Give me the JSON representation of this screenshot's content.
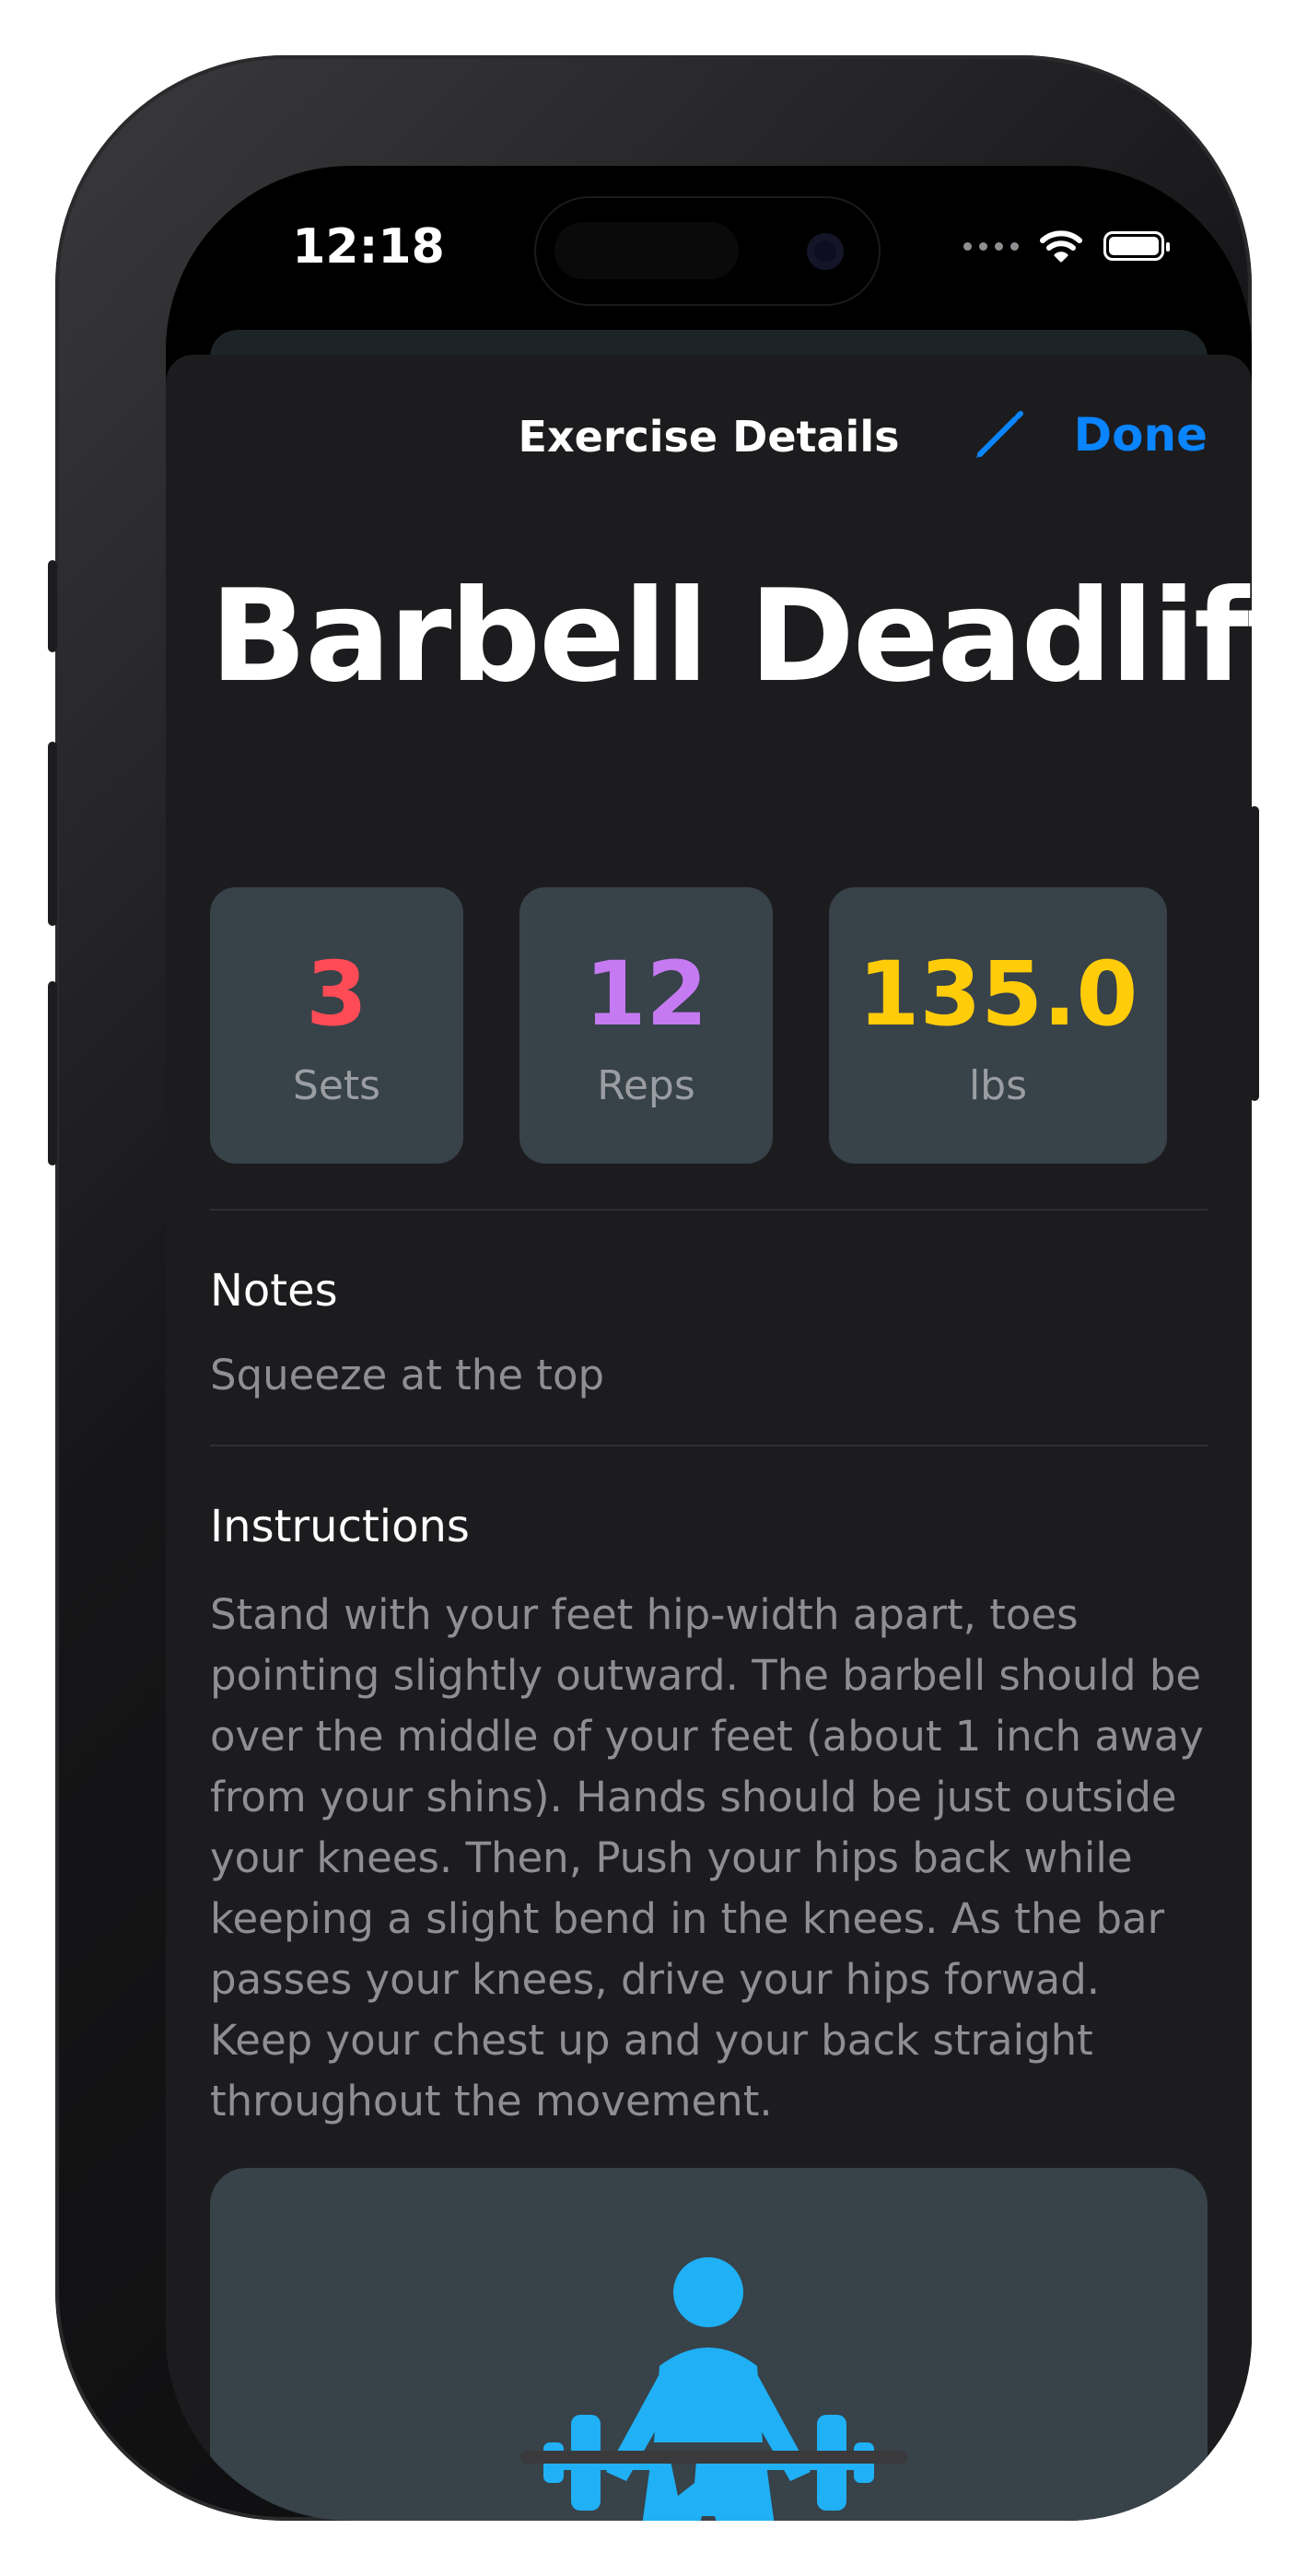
{
  "status_bar": {
    "time": "12:18"
  },
  "header": {
    "title": "Exercise Details",
    "done_label": "Done"
  },
  "exercise": {
    "name": "Barbell Deadlift",
    "stats": [
      {
        "value": "3",
        "label": "Sets",
        "color": "#ff4b55"
      },
      {
        "value": "12",
        "label": "Reps",
        "color": "#c57af2"
      },
      {
        "value": "135.0",
        "label": "lbs",
        "color": "#ffcc0a"
      }
    ],
    "notes_heading": "Notes",
    "notes": "Squeeze at the top",
    "instructions_heading": "Instructions",
    "instructions": "Stand with your feet hip-width apart, toes pointing slightly outward. The barbell should be over the middle of your feet (about 1 inch away from your shins). Hands should be just outside your knees. Then, Push your hips back while keeping a slight bend in the knees. As the bar passes your knees, drive your hips forwad. Keep your chest up and your back straight throughout the movement."
  },
  "icons": {
    "edit": "pencil-icon",
    "illustration": "weightlifter-icon",
    "accent": "#0a84ff",
    "illustration_color": "#1fb0f5"
  }
}
